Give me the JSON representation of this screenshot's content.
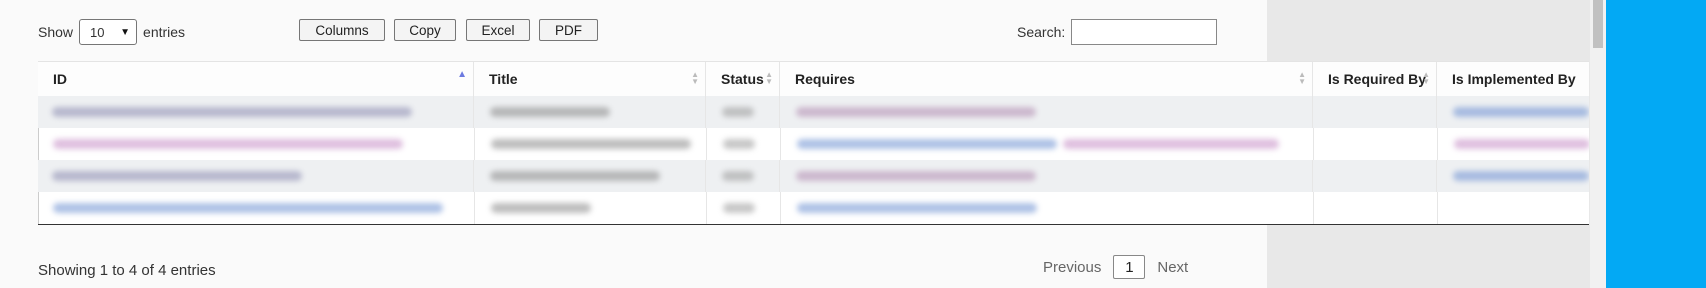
{
  "length_menu": {
    "prefix": "Show",
    "selected": "10",
    "suffix": "entries"
  },
  "buttons": {
    "columns": "Columns",
    "copy": "Copy",
    "excel": "Excel",
    "pdf": "PDF"
  },
  "search": {
    "label": "Search:",
    "value": ""
  },
  "table": {
    "headers": [
      "ID",
      "Title",
      "Status",
      "Requires",
      "Is Required By",
      "Is Implemented By"
    ],
    "sorted_column": "ID",
    "sort_direction": "ascending"
  },
  "info": "Showing 1 to 4 of 4 entries",
  "pagination": {
    "previous": "Previous",
    "current_page": "1",
    "next": "Next"
  },
  "colors": {
    "accent_blue": "#03a9f4",
    "sort_indicator": "#6c7ae0"
  }
}
